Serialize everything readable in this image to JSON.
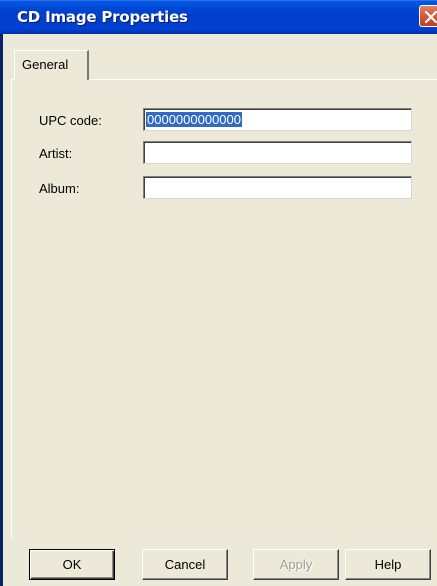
{
  "window": {
    "title": "CD Image Properties"
  },
  "tabs": [
    {
      "label": "General"
    }
  ],
  "fields": {
    "upc": {
      "label": "UPC code:",
      "value": "0000000000000"
    },
    "artist": {
      "label": "Artist:",
      "value": ""
    },
    "album": {
      "label": "Album:",
      "value": ""
    }
  },
  "buttons": {
    "ok": "OK",
    "cancel": "Cancel",
    "apply": "Apply",
    "help": "Help"
  },
  "colors": {
    "titlebar": "#0043cf",
    "selection": "#316ac5",
    "dialog_bg": "#ece9d8",
    "close_button": "#d2583a"
  }
}
